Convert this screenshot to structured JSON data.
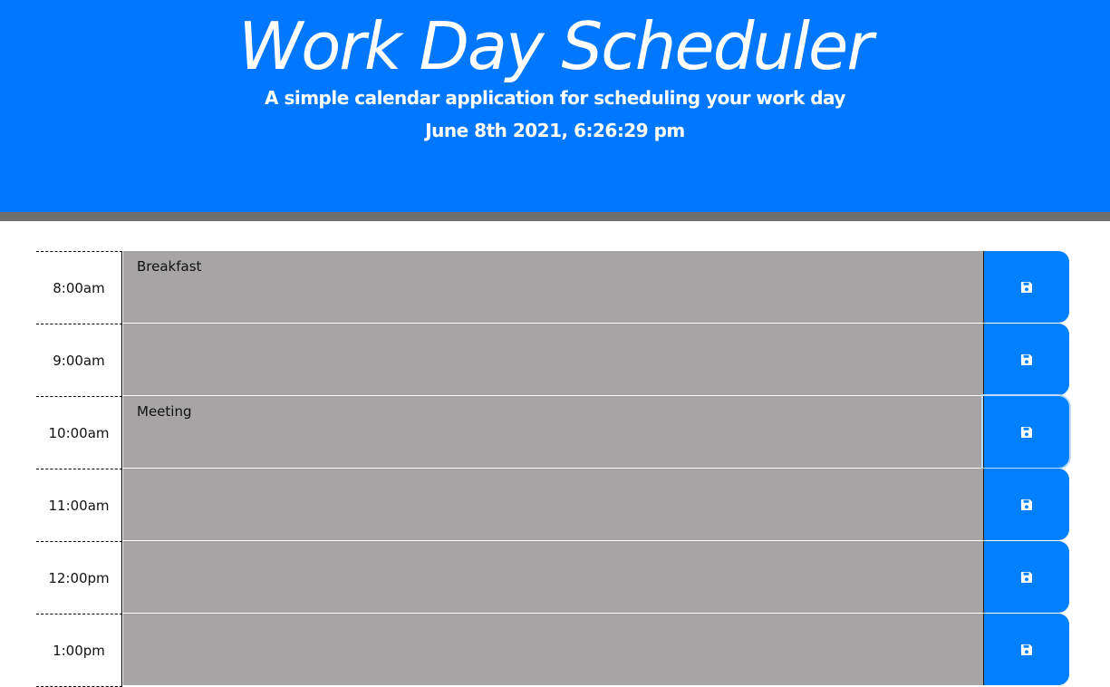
{
  "header": {
    "title": "Work Day Scheduler",
    "lead": "A simple calendar application for scheduling your work day",
    "current_day": "June 8th 2021, 6:26:29 pm"
  },
  "colors": {
    "header_bg": "#0077ff",
    "divider": "#6f6f6f",
    "past_block": "#a6a4a4",
    "save_button": "#0080ff"
  },
  "time_blocks": [
    {
      "hour": "8:00am",
      "text": "Breakfast",
      "state": "past"
    },
    {
      "hour": "9:00am",
      "text": "",
      "state": "past"
    },
    {
      "hour": "10:00am",
      "text": "Meeting",
      "state": "past"
    },
    {
      "hour": "11:00am",
      "text": "",
      "state": "past"
    },
    {
      "hour": "12:00pm",
      "text": "",
      "state": "past"
    },
    {
      "hour": "1:00pm",
      "text": "",
      "state": "past"
    }
  ],
  "save_icon": "save-icon"
}
